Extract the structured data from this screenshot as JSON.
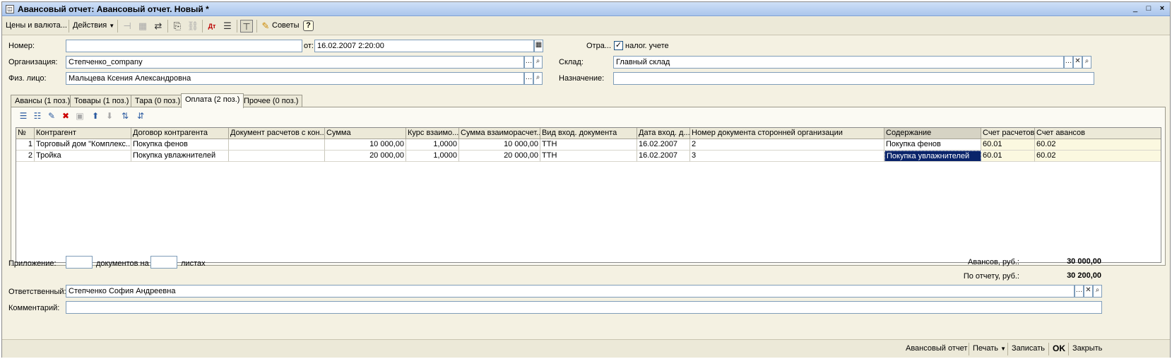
{
  "window": {
    "title": "Авансовый отчет: Авансовый отчет. Новый *",
    "controls": [
      "_",
      "□",
      "×"
    ]
  },
  "toolbar": {
    "prices_label": "Цены и валюта...",
    "actions_label": "Действия",
    "tips_label": "Советы",
    "help_label": "?"
  },
  "header": {
    "number_label": "Номер:",
    "number_value": "",
    "from_label": "от:",
    "date_value": "16.02.2007  2:20:00",
    "reflect_label": "Отра...",
    "tax_label": "налог. учете",
    "tax_checked": "✓",
    "org_label": "Организация:",
    "org_value": "Степченко_company",
    "warehouse_label": "Склад:",
    "warehouse_value": "Главный склад",
    "person_label": "Физ. лицо:",
    "person_value": "Мальцева Ксения Александровна",
    "purpose_label": "Назначение:",
    "purpose_value": ""
  },
  "tabs": [
    {
      "label": "Авансы (1 поз.)"
    },
    {
      "label": "Товары (1 поз.)"
    },
    {
      "label": "Тара (0 поз.)"
    },
    {
      "label": "Оплата (2 поз.)"
    },
    {
      "label": "Прочее (0 поз.)"
    }
  ],
  "grid": {
    "columns": [
      "№",
      "Контрагент",
      "Договор контрагента",
      "Документ расчетов с кон...",
      "Сумма",
      "Курс взаимо...",
      "Сумма взаиморасчет...",
      "Вид вход. документа",
      "Дата вход. д...",
      "Номер документа сторонней организации",
      "Содержание",
      "Счет расчетов",
      "Счет авансов"
    ],
    "rows": [
      {
        "n": "1",
        "contractor": "Торговый дом \"Комплекс...",
        "contract": "Покупка фенов",
        "doc": "",
        "sum": "10 000,00",
        "rate": "1,0000",
        "sum_settle": "10 000,00",
        "doc_type": "ТТН",
        "date": "16.02.2007",
        "ext_num": "2",
        "content": "Покупка фенов",
        "acc_settle": "60.01",
        "acc_adv": "60.02"
      },
      {
        "n": "2",
        "contractor": "Тройка",
        "contract": "Покупка увлажнителей",
        "doc": "",
        "sum": "20 000,00",
        "rate": "1,0000",
        "sum_settle": "20 000,00",
        "doc_type": "ТТН",
        "date": "16.02.2007",
        "ext_num": "3",
        "content": "Покупка увлажнителей",
        "acc_settle": "60.01",
        "acc_adv": "60.02"
      }
    ]
  },
  "footer": {
    "attach_label": "Приложение:",
    "docs_label": "документов на",
    "sheets_label": "листах",
    "advances_label": "Авансов, руб.:",
    "advances_value": "30 000,00",
    "report_label": "По отчету, руб.:",
    "report_value": "30 200,00",
    "responsible_label": "Ответственный:",
    "responsible_value": "Степченко София Андреевна",
    "comment_label": "Комментарий:",
    "comment_value": ""
  },
  "statusbar": {
    "report_btn": "Авансовый отчет",
    "print_btn": "Печать",
    "save_btn": "Записать",
    "ok_btn": "OK",
    "close_btn": "Закрыть"
  }
}
